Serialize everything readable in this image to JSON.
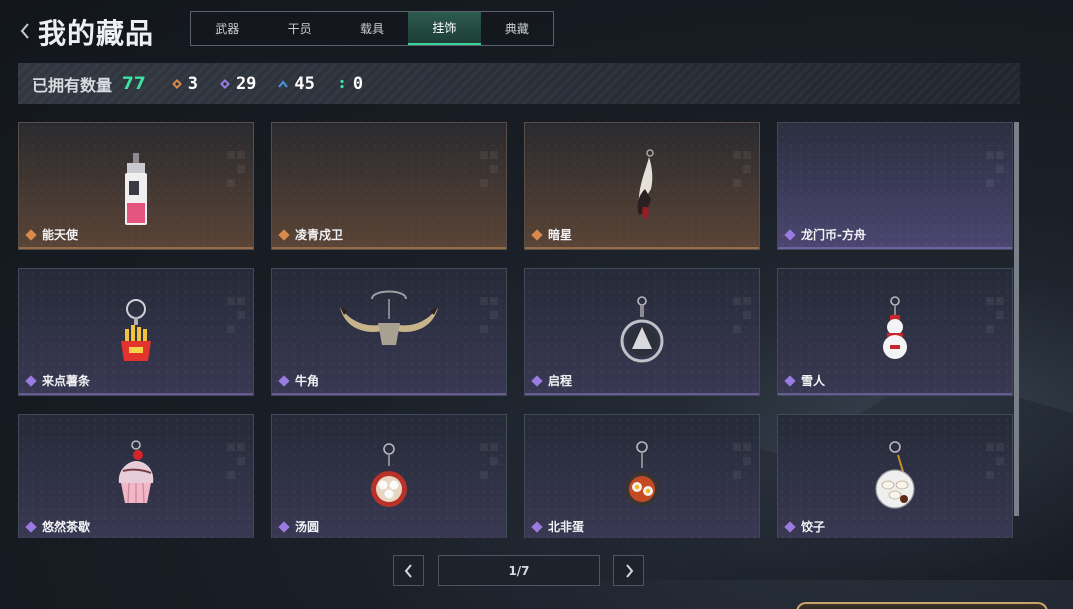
{
  "header": {
    "title": "我的藏品",
    "tabs": [
      {
        "label": "武器",
        "active": false
      },
      {
        "label": "干员",
        "active": false
      },
      {
        "label": "载具",
        "active": false
      },
      {
        "label": "挂饰",
        "active": true
      },
      {
        "label": "典藏",
        "active": false
      }
    ]
  },
  "stats": {
    "owned_label": "已拥有数量",
    "owned_total": "77",
    "counts": [
      {
        "icon": "gold-diamond-icon",
        "value": "3",
        "color": "#d88a4c"
      },
      {
        "icon": "purple-diamond-icon",
        "value": "29",
        "color": "#9a7be0"
      },
      {
        "icon": "blue-chevron-icon",
        "value": "45",
        "color": "#4f8fd6"
      },
      {
        "icon": "green-dots-icon",
        "value": "0",
        "color": "#3be3a1"
      }
    ]
  },
  "items": [
    {
      "name": "能天使",
      "rarity": "gold",
      "art": "can-charm"
    },
    {
      "name": "凌青戍卫",
      "rarity": "gold",
      "art": "empty"
    },
    {
      "name": "暗星",
      "rarity": "gold",
      "art": "feather-charm"
    },
    {
      "name": "龙门币-方舟",
      "rarity": "purple",
      "art": "empty"
    },
    {
      "name": "来点薯条",
      "rarity": "purple",
      "art": "fries-charm"
    },
    {
      "name": "牛角",
      "rarity": "purple",
      "art": "horn-charm"
    },
    {
      "name": "启程",
      "rarity": "purple",
      "art": "medal-charm"
    },
    {
      "name": "雪人",
      "rarity": "purple",
      "art": "snowman-charm"
    },
    {
      "name": "悠然茶歇",
      "rarity": "purple",
      "art": "cupcake-charm"
    },
    {
      "name": "汤圆",
      "rarity": "purple",
      "art": "bowl-charm"
    },
    {
      "name": "北非蛋",
      "rarity": "purple",
      "art": "pan-charm"
    },
    {
      "name": "饺子",
      "rarity": "purple",
      "art": "dumpling-charm"
    }
  ],
  "pagination": {
    "label": "1/7"
  },
  "colors": {
    "accent_green": "#3be3a1",
    "gold_rarity": "#d88a4c",
    "purple_rarity": "#9a7be0"
  }
}
